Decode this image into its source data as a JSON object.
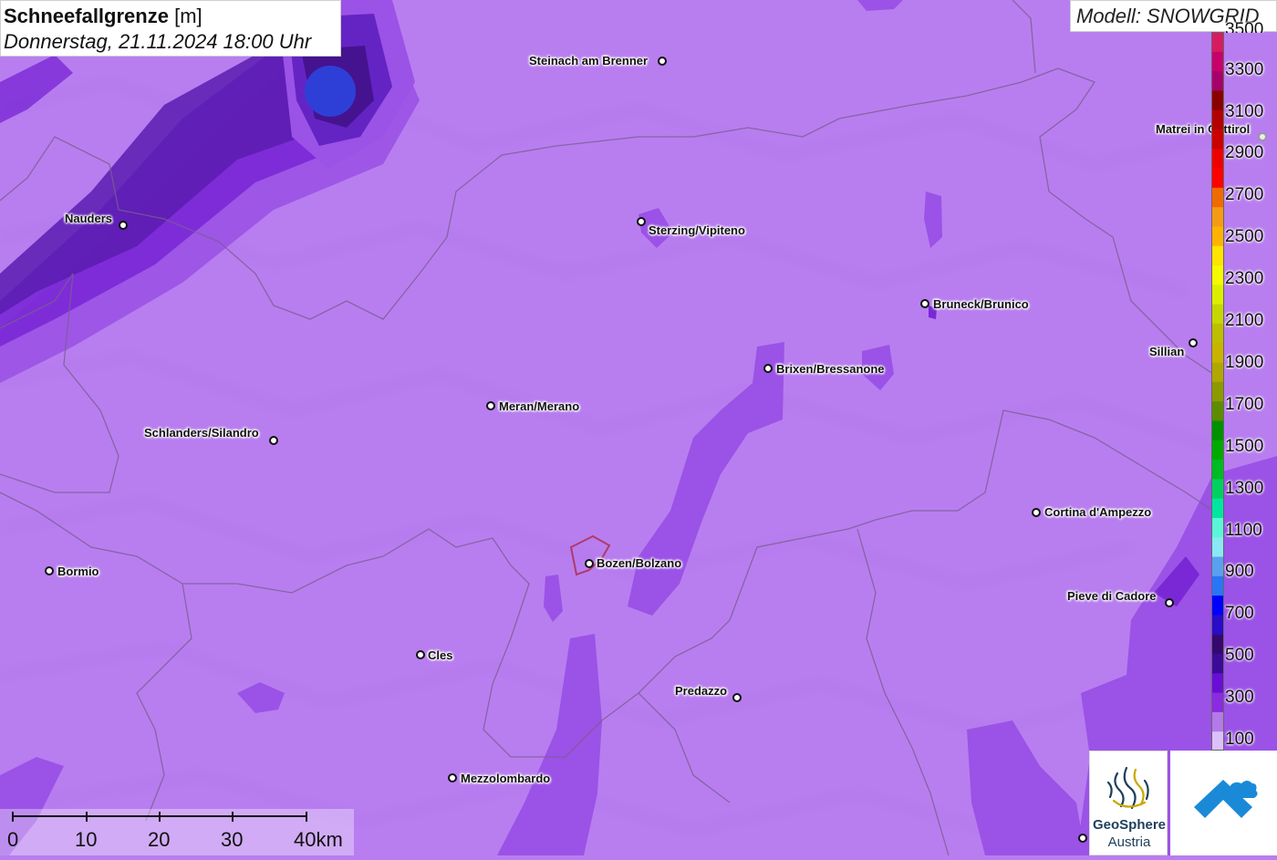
{
  "title": {
    "main": "Schneefallgrenze",
    "unit": "[m]",
    "datetime": "Donnerstag, 21.11.2024 18:00 Uhr"
  },
  "model": "Modell: SNOWGRID",
  "places": [
    {
      "name": "Steinach am Brenner"
    },
    {
      "name": "Nauders"
    },
    {
      "name": "Sterzing/Vipiteno"
    },
    {
      "name": "Matrei in Osttirol"
    },
    {
      "name": "Bruneck/Brunico"
    },
    {
      "name": "Sillian"
    },
    {
      "name": "Brixen/Bressanone"
    },
    {
      "name": "Meran/Merano"
    },
    {
      "name": "Schlanders/Silandro"
    },
    {
      "name": "Cortina d'Ampezzo"
    },
    {
      "name": "Bormio"
    },
    {
      "name": "Bozen/Bolzano"
    },
    {
      "name": "Pieve di Cadore"
    },
    {
      "name": "Cles"
    },
    {
      "name": "Predazzo"
    },
    {
      "name": "Mezzolombardo"
    }
  ],
  "scale_bar": {
    "labels": [
      "0",
      "10",
      "20",
      "30",
      "40km"
    ]
  },
  "legend": {
    "labels": [
      "100",
      "300",
      "500",
      "700",
      "900",
      "1100",
      "1300",
      "1500",
      "1700",
      "1900",
      "2100",
      "2300",
      "2500",
      "2700",
      "2900",
      "3100",
      "3300",
      "3500"
    ],
    "colors": [
      "#dcc0fb",
      "#b37ae8",
      "#8a2be2",
      "#6a0dd6",
      "#3c0a99",
      "#35086f",
      "#2a0bc8",
      "#0000ff",
      "#2a75f5",
      "#5aa0f0",
      "#8ae9f5",
      "#5cf5d8",
      "#00e6a0",
      "#00d060",
      "#00bb22",
      "#00aa00",
      "#009000",
      "#5e8c00",
      "#8c9a00",
      "#b2a600",
      "#c8b400",
      "#bebe00",
      "#c6d600",
      "#dcef00",
      "#f5fa00",
      "#ffe400",
      "#ffb300",
      "#f59a14",
      "#f06a00",
      "#ff0000",
      "#ee0000",
      "#cc0000",
      "#b30000",
      "#8a0000",
      "#a8006a",
      "#c8006b",
      "#d81b60"
    ],
    "top_value": "3500"
  },
  "logos": {
    "geosphere_line1": "GeoSphere",
    "geosphere_line2": "Austria"
  },
  "colors": {
    "base": "#b87ef0",
    "medium": "#9b52e6",
    "dark": "#7a28d6",
    "deep": "#45138f",
    "core": "#2e3fd8"
  }
}
